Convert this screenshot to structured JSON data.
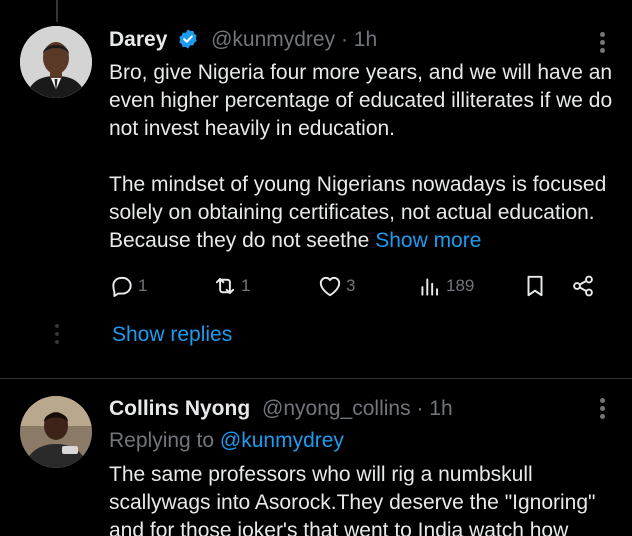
{
  "tweet1": {
    "name": "Darey",
    "handle": "@kunmydrey",
    "separator": "·",
    "time": "1h",
    "paragraph1": "Bro, give Nigeria four more years, and we will have an even higher percentage of educated illiterates if we do not invest heavily in education.",
    "paragraph2": "The mindset of young Nigerians nowadays is focused solely on obtaining certificates, not actual education. Because they do not seethe",
    "show_more": "Show more",
    "actions": {
      "replies": "1",
      "reposts": "1",
      "likes": "3",
      "views": "189"
    },
    "show_replies": "Show replies"
  },
  "tweet2": {
    "name": "Collins Nyong",
    "handle": "@nyong_collins",
    "separator": "·",
    "time": "1h",
    "replying_prefix": "Replying to ",
    "replying_to": "@kunmydrey",
    "body": "The same professors who will rig a numbskull scallywags into Asorock.They deserve the \"Ignoring\" and for those joker's that went to India watch how"
  },
  "colors": {
    "background": "#000000",
    "text": "#e7e9ea",
    "muted": "#71767b",
    "accent": "#1d9bf0",
    "divider": "#2f3336"
  },
  "icons": [
    "verified-badge-icon",
    "more-icon",
    "reply-icon",
    "repost-icon",
    "like-icon",
    "views-icon",
    "bookmark-icon",
    "share-icon"
  ]
}
